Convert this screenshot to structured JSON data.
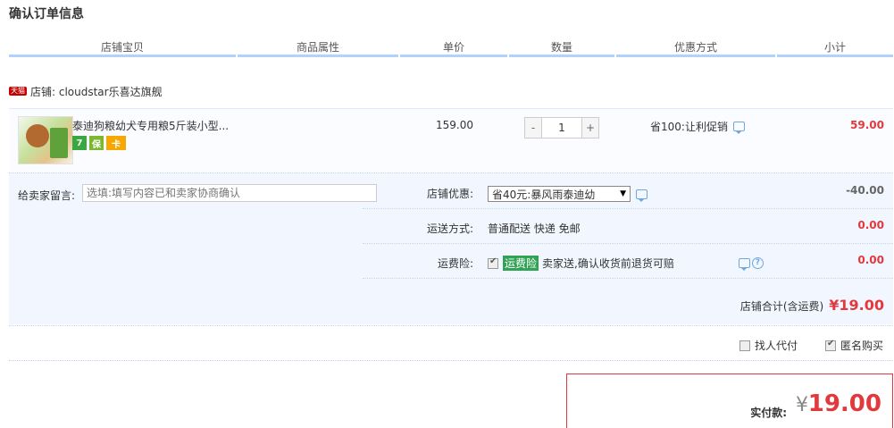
{
  "page_title": "确认订单信息",
  "columns": [
    "店铺宝贝",
    "商品属性",
    "单价",
    "数量",
    "优惠方式",
    "小计"
  ],
  "shop": {
    "badge": "天猫",
    "label": "店铺: cloudstar乐喜达旗舰"
  },
  "item": {
    "title": "泰迪狗粮幼犬专用粮5斤装小型...",
    "service_icons": [
      {
        "icon": "seven-day-return-icon",
        "glyph": "7"
      },
      {
        "icon": "insurance-icon",
        "glyph": "保"
      },
      {
        "icon": "credit-card-icon",
        "glyph": "卡"
      }
    ],
    "unit_price": "159.00",
    "quantity": "1",
    "minus": "-",
    "plus": "+",
    "promotion": "省100:让利促销",
    "subtotal": "59.00"
  },
  "memo": {
    "label": "给卖家留言:",
    "placeholder": "选填:填写内容已和卖家协商确认"
  },
  "shop_discount": {
    "label": "店铺优惠:",
    "selected": "省40元:暴风雨泰迪幼",
    "amount": "-40.00"
  },
  "shipping": {
    "label": "运送方式:",
    "value": "普通配送 快递 免邮",
    "amount": "0.00"
  },
  "shipping_insurance": {
    "label": "运费险:",
    "tag": "运费险",
    "text": "卖家送,确认收货前退货可赔",
    "amount": "0.00"
  },
  "shop_total": {
    "label": "店铺合计(含运费)",
    "value": "¥19.00"
  },
  "extra_options": {
    "proxy_pay": "找人代付",
    "anonymous": "匿名购买"
  },
  "payment": {
    "label": "实付款:",
    "currency": "¥",
    "value": "19.00"
  },
  "colors": {
    "accent_red": "#e4393c",
    "header_line": "#b2d1ff",
    "panel_bg": "#f2f7ff"
  }
}
